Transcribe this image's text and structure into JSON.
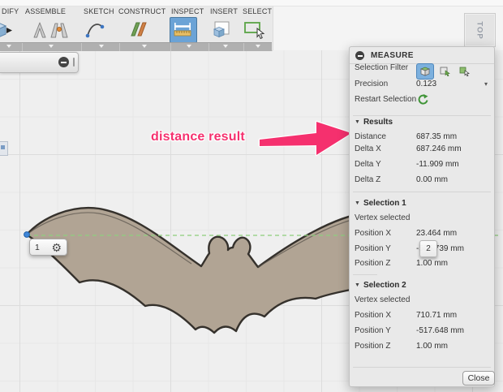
{
  "toolbar": {
    "tabs": [
      {
        "label": "DIFY"
      },
      {
        "label": "ASSEMBLE"
      },
      {
        "label": "SKETCH"
      },
      {
        "label": "CONSTRUCT"
      },
      {
        "label": "INSPECT"
      },
      {
        "label": "INSERT"
      },
      {
        "label": "SELECT"
      }
    ]
  },
  "viewcube": {
    "label": "TOP"
  },
  "annotation": {
    "text": "distance result",
    "color": "#f5306e"
  },
  "canvas_overlays": {
    "selection1_badge": "1",
    "selection2_badge": "2",
    "bat_fill_color": "#b1a494",
    "measure_line_color": "#8fcf7f"
  },
  "panel": {
    "title": "MEASURE",
    "selection_filter_label": "Selection Filter",
    "precision_label": "Precision",
    "precision_value": "0.123",
    "restart_label": "Restart Selection",
    "results": {
      "header": "Results",
      "rows": [
        {
          "label": "Distance",
          "value": "687.35 mm"
        },
        {
          "label": "Delta X",
          "value": "687.246 mm"
        },
        {
          "label": "Delta Y",
          "value": "-11.909 mm"
        },
        {
          "label": "Delta Z",
          "value": "0.00 mm"
        }
      ]
    },
    "selection1": {
      "header": "Selection 1",
      "type": "Vertex selected",
      "rows": [
        {
          "label": "Position X",
          "value": "23.464 mm"
        },
        {
          "label": "Position Y",
          "value": "-505.739 mm"
        },
        {
          "label": "Position Z",
          "value": "1.00 mm"
        }
      ]
    },
    "selection2": {
      "header": "Selection 2",
      "type": "Vertex selected",
      "rows": [
        {
          "label": "Position X",
          "value": "710.71 mm"
        },
        {
          "label": "Position Y",
          "value": "-517.648 mm"
        },
        {
          "label": "Position Z",
          "value": "1.00 mm"
        }
      ]
    },
    "close_label": "Close"
  }
}
